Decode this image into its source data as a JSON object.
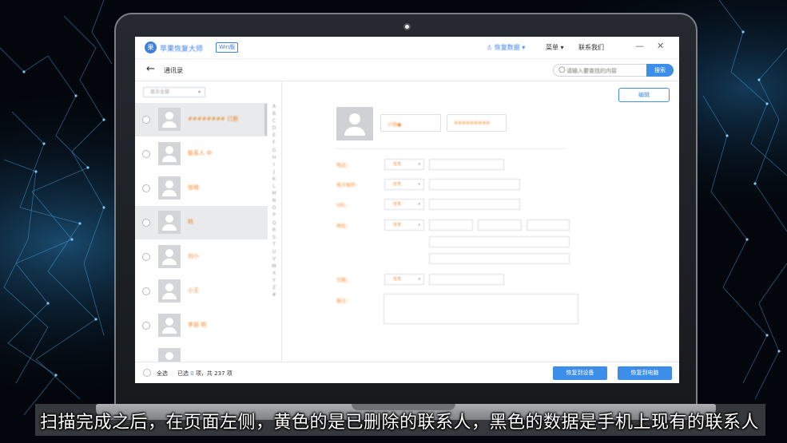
{
  "app": {
    "title": "苹果恢复大师",
    "version_badge": "Win版",
    "logo_glyph": "果",
    "user": "恢复数据",
    "menu": "菜单",
    "contact_us": "联系我们",
    "minimize_glyph": "—",
    "close_glyph": "✕"
  },
  "nav": {
    "back_glyph": "←",
    "title": "通讯录",
    "search_placeholder": "请输入要查找的内容",
    "search_button": "搜索",
    "search_glyph": "○"
  },
  "list": {
    "filter": "显示全部",
    "filter_caret": "▾",
    "contacts": [
      {
        "name": "########  已删"
      },
      {
        "name": "联系人  中"
      },
      {
        "name": "张晓"
      },
      {
        "name": "韩"
      },
      {
        "name": "刘小"
      },
      {
        "name": "小王"
      },
      {
        "name": "李丽  明"
      },
      {
        "name": ""
      }
    ],
    "index_letters": [
      "A",
      "B",
      "C",
      "D",
      "E",
      "F",
      "G",
      "H",
      "I",
      "J",
      "K",
      "L",
      "M",
      "N",
      "O",
      "P",
      "Q",
      "R",
      "S",
      "T",
      "U",
      "V",
      "W",
      "X",
      "Y",
      "Z",
      "#"
    ]
  },
  "detail": {
    "edit_button": "编辑",
    "name_field": "小张●",
    "phone_field": "#########",
    "labels": [
      "电话：",
      "电子邮件：",
      "URL：",
      "地址：",
      "日期：",
      "备注："
    ],
    "type_select": "住宅",
    "caret": "▾"
  },
  "bottom": {
    "select_all": "全选",
    "selected_prefix": "已选",
    "selected_count": "0",
    "selected_mid": "项，共",
    "total_count": "237",
    "selected_suffix": "项",
    "restore_device": "恢复到设备",
    "restore_pc": "恢复到电脑"
  },
  "subtitle": "扫描完成之后，在页面左侧，黄色的是已删除的联系人，黑色的数据是手机上现有的联系人",
  "colors": {
    "accent": "#3d8ee8",
    "deleted_contact": "#f08a30",
    "background": "#03070d"
  }
}
